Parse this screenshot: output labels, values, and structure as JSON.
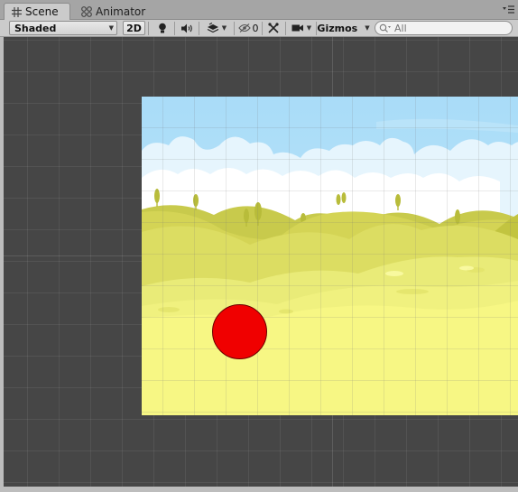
{
  "tabs": {
    "scene": {
      "label": "Scene",
      "icon": "scene-hash-icon"
    },
    "animator": {
      "label": "Animator",
      "icon": "animator-icon"
    }
  },
  "toolbar": {
    "shading_mode": "Shaded",
    "mode_2d": "2D",
    "hidden_count": "0",
    "gizmos": "Gizmos",
    "search": {
      "placeholder": "All"
    }
  },
  "scene": {
    "background": "cartoon-hills-sky",
    "object": {
      "name": "red-circle-sprite",
      "color": "#f00000"
    }
  }
}
